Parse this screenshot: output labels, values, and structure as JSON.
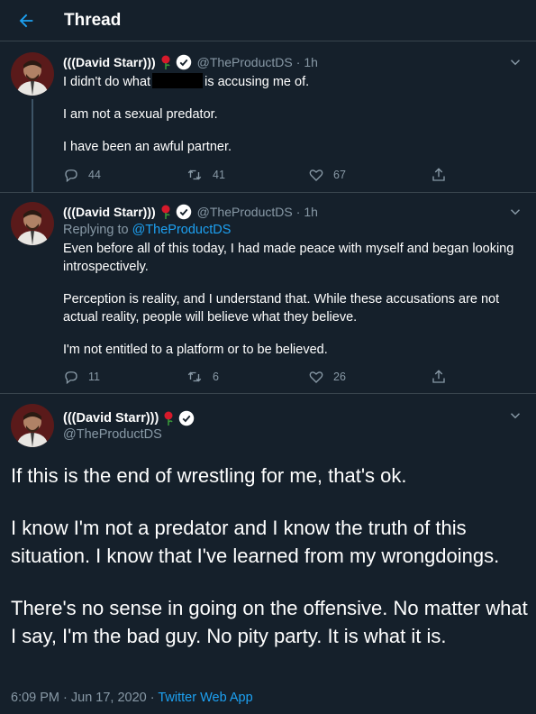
{
  "header": {
    "title": "Thread",
    "back_icon": "arrow-left-icon"
  },
  "colors": {
    "background": "#15202b",
    "accent": "#1da1f2",
    "muted": "#8899a6",
    "border": "#38444d"
  },
  "tweets": [
    {
      "display_name": "(((David Starr)))",
      "handle": "@TheProductDS",
      "dot": "·",
      "time": "1h",
      "line1_before": "I didn't do what",
      "line1_after": "is accusing me of.",
      "paragraphs": [
        "I am not a sexual predator.",
        "I have been an awful partner."
      ],
      "replies": "44",
      "retweets": "41",
      "likes": "67"
    },
    {
      "display_name": "(((David Starr)))",
      "handle": "@TheProductDS",
      "dot": "·",
      "time": "1h",
      "replying_label": "Replying to",
      "replying_to": "@TheProductDS",
      "paragraphs": [
        "Even before all of this today, I had made peace with myself and began looking introspectively.",
        "Perception is reality, and I understand that. While these accusations are not actual reality, people will believe what they believe.",
        "I'm not entitled to a platform or to be believed."
      ],
      "replies": "11",
      "retweets": "6",
      "likes": "26"
    }
  ],
  "main_tweet": {
    "display_name": "(((David Starr)))",
    "handle": "@TheProductDS",
    "paragraphs": [
      "If this is the end of wrestling for me, that's ok.",
      "I know I'm not a predator and I know the truth of this situation. I know that I've learned from my wrongdoings.",
      "There's no sense in going on the offensive. No matter what I say, I'm the bad guy. No pity party. It is what it is."
    ],
    "timestamp": "6:09 PM · Jun 17, 2020 · ",
    "app": "Twitter Web App"
  }
}
